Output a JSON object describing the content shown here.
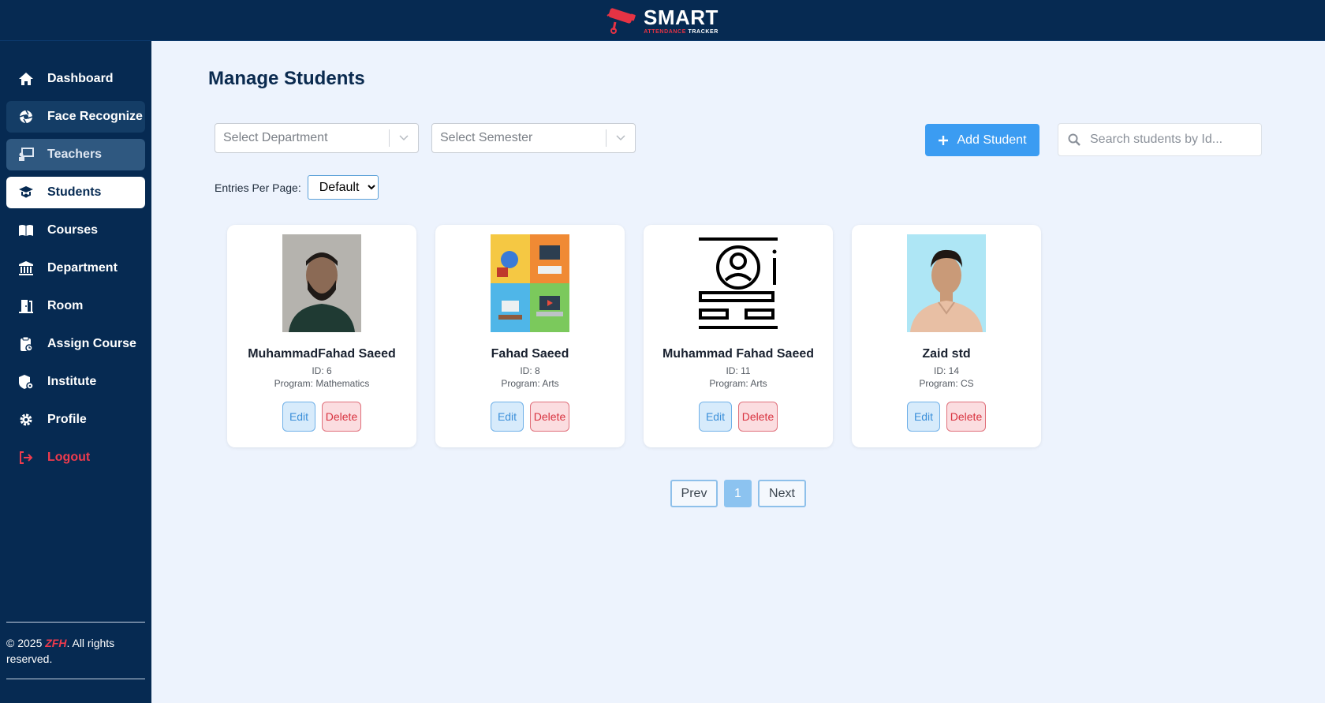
{
  "app": {
    "logo_main": "SMART",
    "logo_sub_red": "ATTENDANCE",
    "logo_sub_white": "TRACKER"
  },
  "sidebar": {
    "items": [
      {
        "label": "Dashboard",
        "icon": "home-icon"
      },
      {
        "label": "Face Recognize",
        "icon": "aperture-icon"
      },
      {
        "label": "Teachers",
        "icon": "teacher-board-icon"
      },
      {
        "label": "Students",
        "icon": "graduation-cap-icon"
      },
      {
        "label": "Courses",
        "icon": "book-icon"
      },
      {
        "label": "Department",
        "icon": "building-columns-icon"
      },
      {
        "label": "Room",
        "icon": "door-icon"
      },
      {
        "label": "Assign Course",
        "icon": "clipboard-icon"
      },
      {
        "label": "Institute",
        "icon": "institute-icon"
      },
      {
        "label": "Profile",
        "icon": "gear-icon"
      },
      {
        "label": "Logout",
        "icon": "logout-icon"
      }
    ],
    "active": "Students",
    "footer_prefix": "© 2025 ",
    "footer_brand": "ZFH",
    "footer_suffix": ". All rights reserved."
  },
  "main": {
    "title": "Manage Students",
    "department_placeholder": "Select Department",
    "semester_placeholder": "Select Semester",
    "add_button": "Add Student",
    "search_placeholder": "Search students by Id...",
    "entries_label": "Entries Per Page:",
    "entries_value": "Default"
  },
  "students": [
    {
      "name": "MuhammadFahad Saeed",
      "id": "ID: 6",
      "program": "Program: Mathematics",
      "edit": "Edit",
      "delete": "Delete"
    },
    {
      "name": "Fahad Saeed",
      "id": "ID: 8",
      "program": "Program: Arts",
      "edit": "Edit",
      "delete": "Delete"
    },
    {
      "name": "Muhammad Fahad Saeed",
      "id": "ID: 11",
      "program": "Program: Arts",
      "edit": "Edit",
      "delete": "Delete"
    },
    {
      "name": "Zaid std",
      "id": "ID: 14",
      "program": "Program: CS",
      "edit": "Edit",
      "delete": "Delete"
    }
  ],
  "pagination": {
    "prev": "Prev",
    "current": "1",
    "next": "Next"
  },
  "colors": {
    "sidebar_bg": "#062a52",
    "accent_blue": "#3b9cf2",
    "danger_red": "#ef3b4d",
    "page_bg": "#edf3fd"
  }
}
